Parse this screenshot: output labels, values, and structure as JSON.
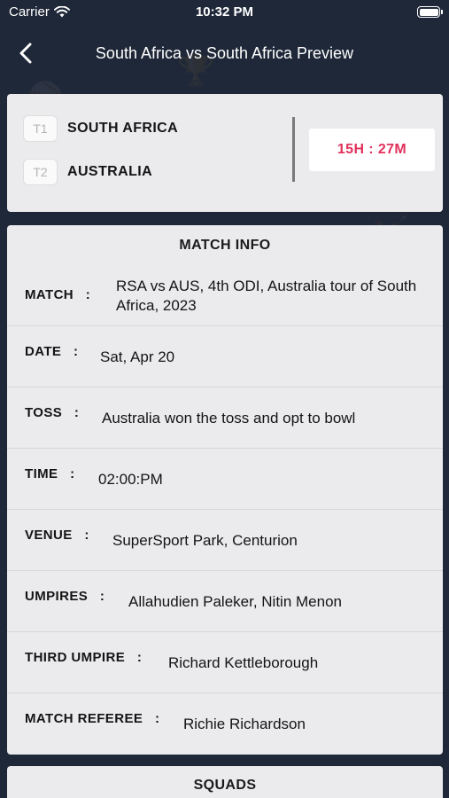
{
  "status_bar": {
    "carrier": "Carrier",
    "time": "10:32 PM"
  },
  "nav": {
    "title": "South Africa vs South Africa Preview",
    "back_icon": "chevron-left-icon"
  },
  "teams": {
    "t1": {
      "badge": "T1",
      "name": "SOUTH AFRICA"
    },
    "t2": {
      "badge": "T2",
      "name": "AUSTRALIA"
    },
    "countdown": "15H : 27M"
  },
  "match_info": {
    "title": "MATCH INFO",
    "rows": [
      {
        "label": "MATCH",
        "sep": ":",
        "value": "RSA vs AUS, 4th ODI, Australia tour of South Africa, 2023"
      },
      {
        "label": "DATE",
        "sep": ":",
        "value": "Sat, Apr 20"
      },
      {
        "label": "TOSS",
        "sep": ":",
        "value": "Australia won the toss and opt to bowl"
      },
      {
        "label": "TIME",
        "sep": ":",
        "value": "02:00:PM"
      },
      {
        "label": "VENUE",
        "sep": ":",
        "value": "SuperSport Park, Centurion"
      },
      {
        "label": "UMPIRES",
        "sep": ":",
        "value": "Allahudien Paleker, Nitin Menon"
      },
      {
        "label": "THIRD UMPIRE",
        "sep": ":",
        "value": "Richard Kettleborough"
      },
      {
        "label": "MATCH REFEREE",
        "sep": ":",
        "value": "Richie Richardson"
      }
    ]
  },
  "squads": {
    "title": "SQUADS"
  },
  "colors": {
    "background": "#1f2838",
    "card": "#ebebee",
    "accent": "#e1315b"
  }
}
